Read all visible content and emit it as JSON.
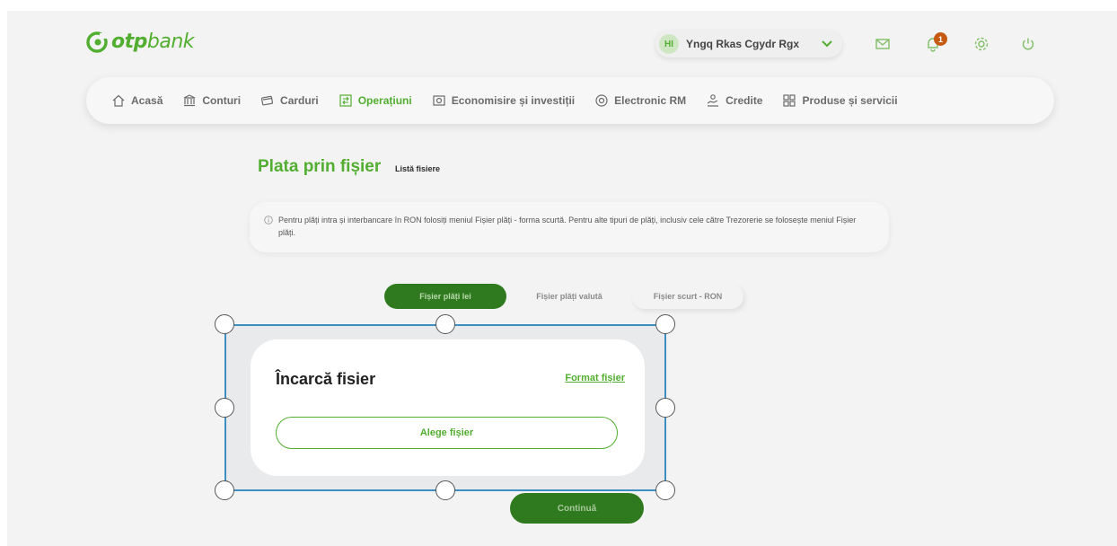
{
  "header": {
    "logo": {
      "bold": "otp",
      "light": "bank"
    },
    "user": {
      "initials": "HI",
      "name": "Yngq Rkas Cgydr Rgx"
    },
    "notifications_count": "1",
    "icons": [
      "mail-icon",
      "bell-icon",
      "gear-icon",
      "power-icon"
    ]
  },
  "nav": {
    "items": [
      {
        "label": "Acasă",
        "icon": "home-icon"
      },
      {
        "label": "Conturi",
        "icon": "bank-icon"
      },
      {
        "label": "Carduri",
        "icon": "card-icon"
      },
      {
        "label": "Operațiuni",
        "icon": "operations-icon",
        "active": true
      },
      {
        "label": "Economisire și investiții",
        "icon": "savings-icon"
      },
      {
        "label": "Electronic RM",
        "icon": "rm-icon"
      },
      {
        "label": "Credite",
        "icon": "credit-icon"
      },
      {
        "label": "Produse și servicii",
        "icon": "products-icon"
      }
    ]
  },
  "page": {
    "title": "Plata prin fișier",
    "link": "Listă fisiere",
    "info": "Pentru plăți intra și interbancare în RON folosiți meniul Fișier plăți - forma scurtă. Pentru alte tipuri de plăți, inclusiv cele către Trezorerie se folosește meniul Fișier plăți."
  },
  "tabs": [
    {
      "label": "Fișier plăți lei",
      "active": true
    },
    {
      "label": "Fișier plăți valută"
    },
    {
      "label": "Fișier scurt - RON"
    }
  ],
  "modal": {
    "title": "Încarcă fisier",
    "format_link": "Format fișier",
    "choose_button": "Alege fișier"
  },
  "continue_button": "Continuă",
  "colors": {
    "brand_green": "#52ae30",
    "dark_green": "#2f7a1e",
    "badge_orange": "#c65a12",
    "selection_blue": "#3d8fc2"
  }
}
